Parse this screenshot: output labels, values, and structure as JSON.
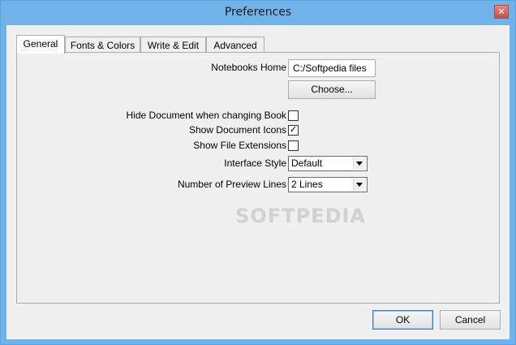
{
  "window": {
    "title": "Preferences"
  },
  "tabs": [
    {
      "label": "General"
    },
    {
      "label": "Fonts & Colors"
    },
    {
      "label": "Write & Edit"
    },
    {
      "label": "Advanced"
    }
  ],
  "general": {
    "notebooks_home_label": "Notebooks Home",
    "notebooks_home_value": "C:/Softpedia files",
    "choose_button": "Choose...",
    "hide_document_label": "Hide Document when changing Book",
    "hide_document_checked": false,
    "show_icons_label": "Show Document Icons",
    "show_icons_checked": true,
    "show_extensions_label": "Show File Extensions",
    "show_extensions_checked": false,
    "interface_style_label": "Interface Style",
    "interface_style_value": "Default",
    "preview_lines_label": "Number of Preview Lines",
    "preview_lines_value": "2 Lines"
  },
  "footer": {
    "ok": "OK",
    "cancel": "Cancel"
  },
  "watermark": "SOFTPEDIA"
}
